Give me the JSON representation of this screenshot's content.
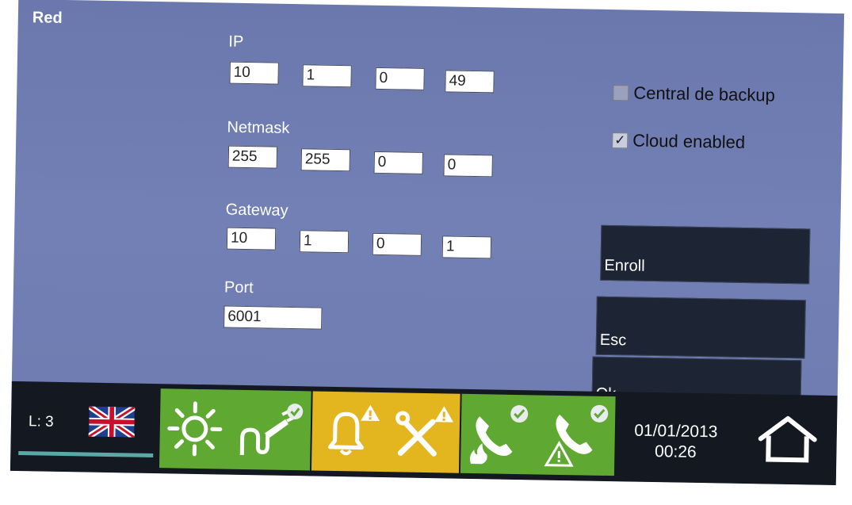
{
  "screen_title": "Red",
  "ip": {
    "label": "IP",
    "octets": [
      "10",
      "1",
      "0",
      "49"
    ]
  },
  "netmask": {
    "label": "Netmask",
    "octets": [
      "255",
      "255",
      "0",
      "0"
    ]
  },
  "gateway": {
    "label": "Gateway",
    "octets": [
      "10",
      "1",
      "0",
      "1"
    ]
  },
  "port": {
    "label": "Port",
    "value": "6001"
  },
  "options": {
    "central_backup": {
      "label": "Central de backup",
      "checked": false
    },
    "cloud_enabled": {
      "label": "Cloud enabled",
      "checked": true
    }
  },
  "buttons": {
    "enroll": "Enroll",
    "esc": "Esc",
    "ok": "Ok"
  },
  "status_bar": {
    "level": "L: 3",
    "language_icon": "uk-flag-icon",
    "date": "01/01/2013",
    "time": "00:26",
    "colors": {
      "green": "#5fa932",
      "yellow": "#e3b51f",
      "bar": "#141820"
    },
    "groups": [
      {
        "color": "green",
        "icons": [
          "sun-icon",
          "power-plug-ok-icon"
        ]
      },
      {
        "color": "yellow",
        "icons": [
          "bell-warning-icon",
          "tools-warning-icon"
        ]
      },
      {
        "color": "green",
        "icons": [
          "phone-fire-ok-icon",
          "phone-warning-ok-icon"
        ]
      }
    ],
    "home_icon": "home-icon"
  }
}
